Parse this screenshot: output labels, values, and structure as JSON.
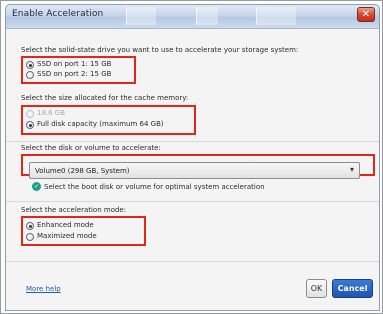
{
  "window": {
    "title": "Enable Acceleration",
    "close_symbol": "✕"
  },
  "drive_section": {
    "label": "Select the solid-state drive you want to use to accelerate your storage system:",
    "options": [
      {
        "label": "SSD on port 1: 15 GB",
        "checked": true
      },
      {
        "label": "SSD on port 2: 15 GB",
        "checked": false
      }
    ]
  },
  "size_section": {
    "label": "Select the size allocated for the cache memory:",
    "options": [
      {
        "label": "18.6 GB",
        "checked": false,
        "disabled": true
      },
      {
        "label": "Full disk capacity (maximum 64 GB)",
        "checked": true
      }
    ]
  },
  "volume_section": {
    "label": "Select the disk or volume to accelerate:",
    "selected": "Volume0 (298 GB, System)",
    "hint": "Select the boot disk or volume for optimal system acceleration"
  },
  "mode_section": {
    "label": "Select the acceleration mode:",
    "options": [
      {
        "label": "Enhanced mode",
        "checked": true
      },
      {
        "label": "Maximized mode",
        "checked": false
      }
    ]
  },
  "footer": {
    "more_help": "More help",
    "ok_label": "OK",
    "cancel_label": "Cancel"
  },
  "icons": {
    "hint": "info-check-icon",
    "dropdown": "chevron-down-icon"
  },
  "colors": {
    "highlight_box": "#e0271d",
    "link": "#1f5fb8",
    "cancel_button": "#1e55b0",
    "hint_icon": "#1d9f8b"
  }
}
